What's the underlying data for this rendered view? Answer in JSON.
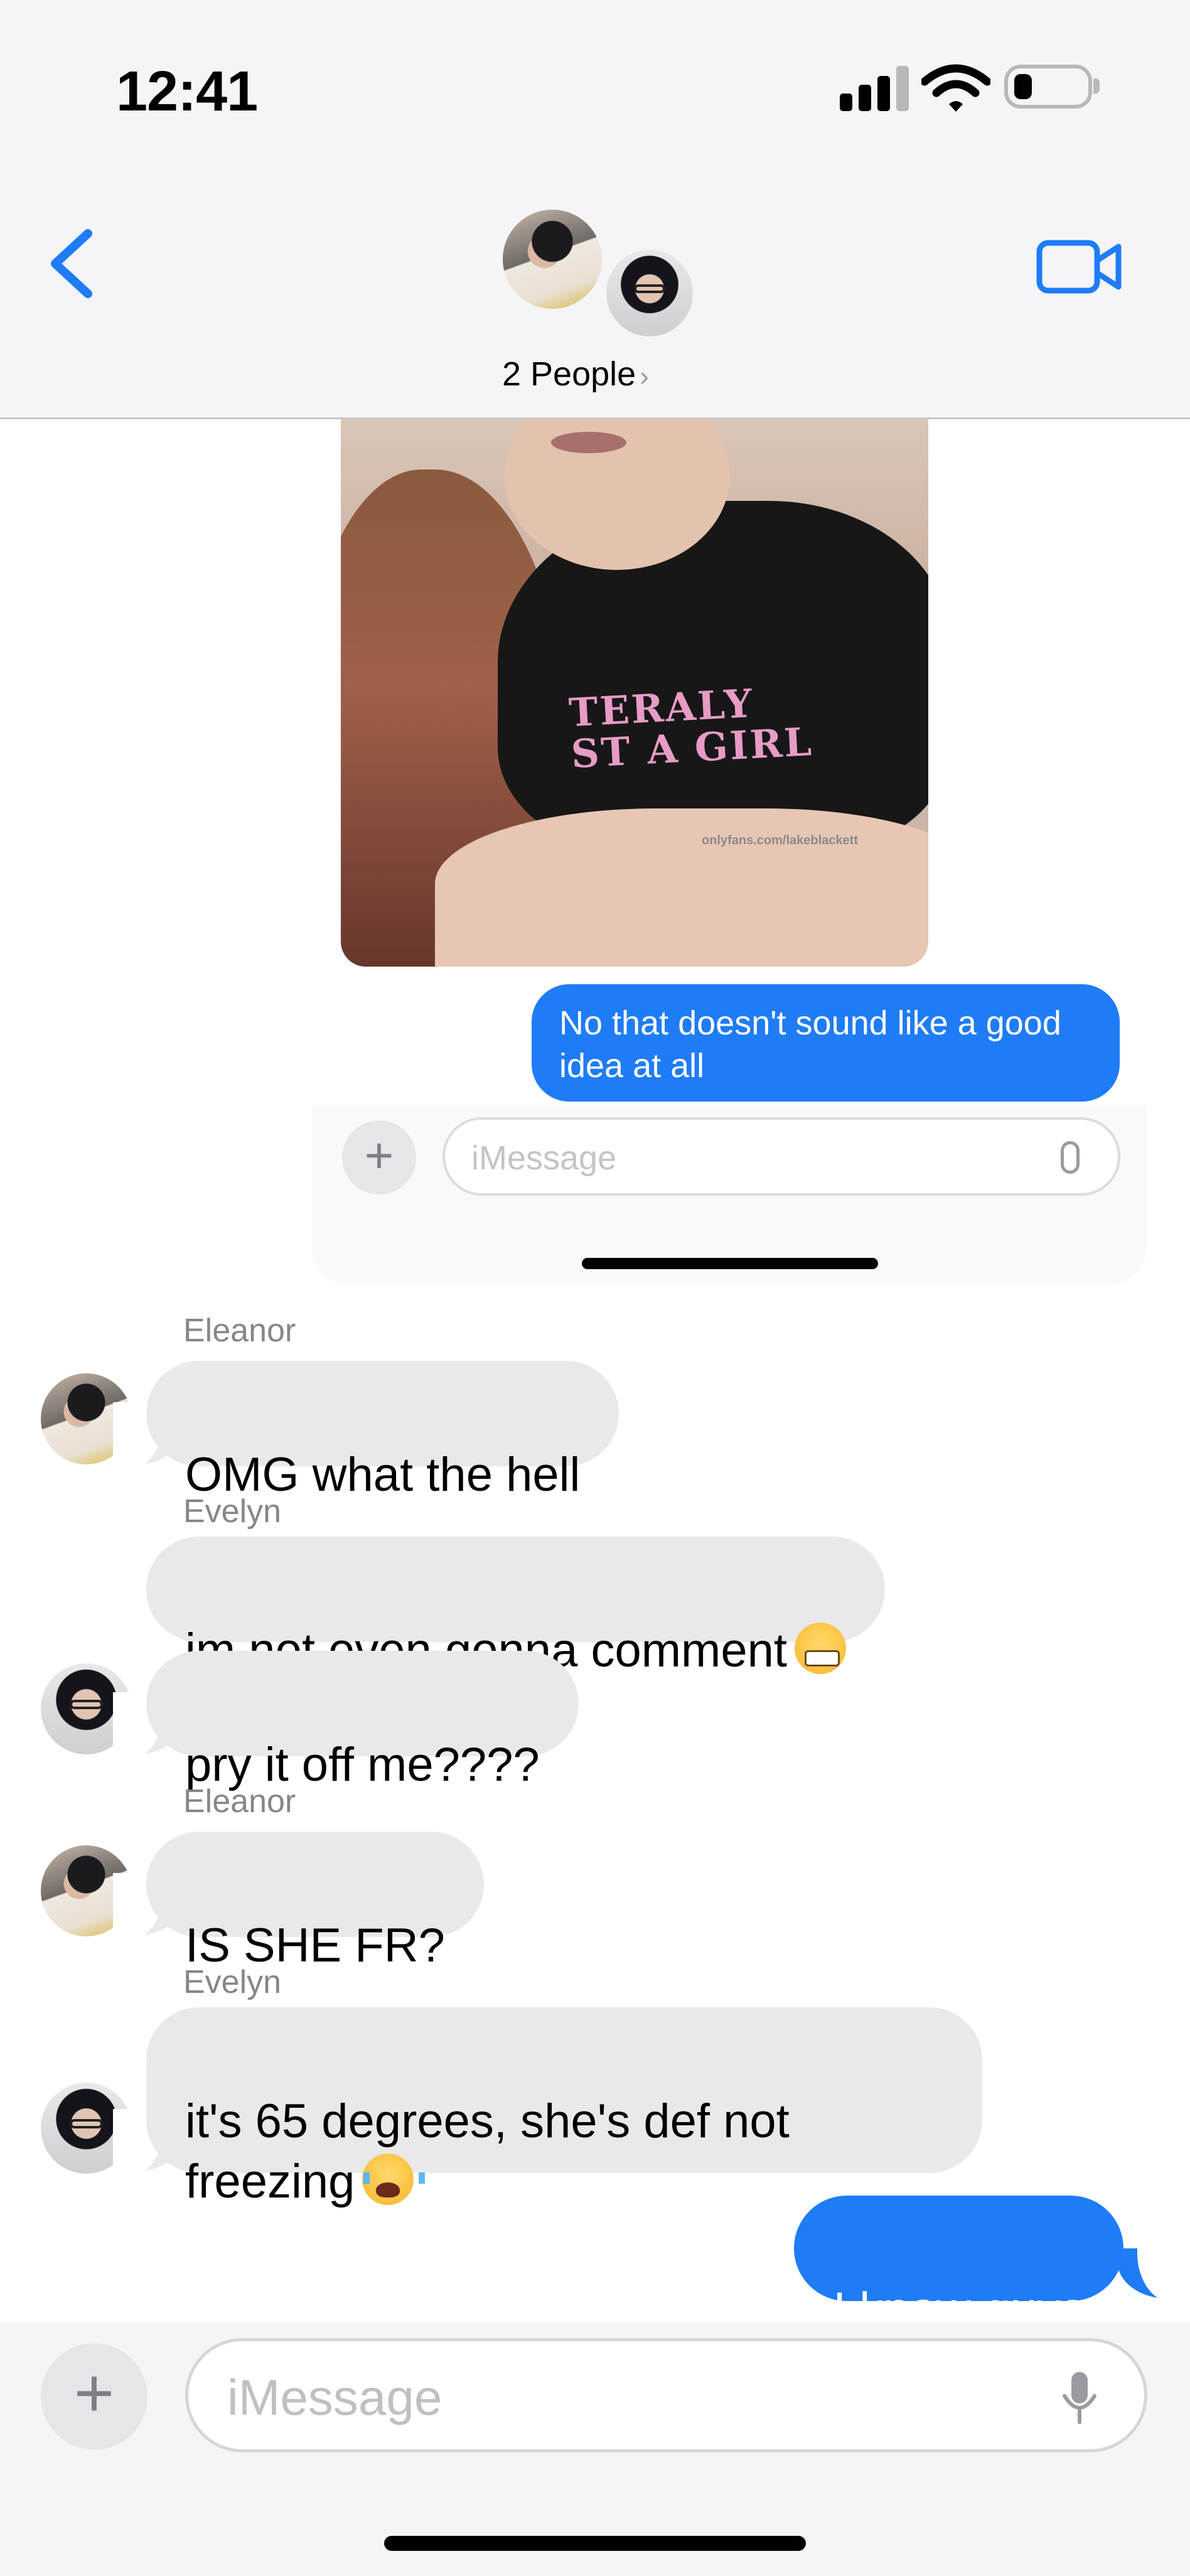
{
  "status_bar": {
    "time": "12:41"
  },
  "header": {
    "group_title": "2 People",
    "chevron": "›",
    "back_icon": "chevron-left-icon",
    "video_icon": "video-camera-icon",
    "accent_color": "#1e7cf7"
  },
  "photo": {
    "shirt_text_line1": "TERALY",
    "shirt_text_line2": "ST A GIRL",
    "watermark": "onlyfans.com/lakeblackett"
  },
  "forwarded_screenshot": {
    "bubble_text": "No that doesn't sound like a good idea at all",
    "input_placeholder": "iMessage",
    "plus_label": "+"
  },
  "messages": [
    {
      "sender": "Eleanor",
      "text": "OMG what the hell",
      "direction": "in"
    },
    {
      "sender": "Evelyn",
      "text": "im not even gonna comment",
      "emoji": "grimacing-face",
      "direction": "in"
    },
    {
      "sender": "",
      "text": "pry it off me????",
      "direction": "in"
    },
    {
      "sender": "Eleanor",
      "text": "IS SHE FR?",
      "direction": "in"
    },
    {
      "sender": "Evelyn",
      "text": "it's 65 degrees, she's def not\nfreezing",
      "emoji": "loudly-crying-face",
      "direction": "in"
    },
    {
      "sender": "",
      "text": "I know guys",
      "direction": "out"
    }
  ],
  "composer": {
    "plus_label": "+",
    "placeholder": "iMessage",
    "mic_icon": "microphone-icon"
  }
}
